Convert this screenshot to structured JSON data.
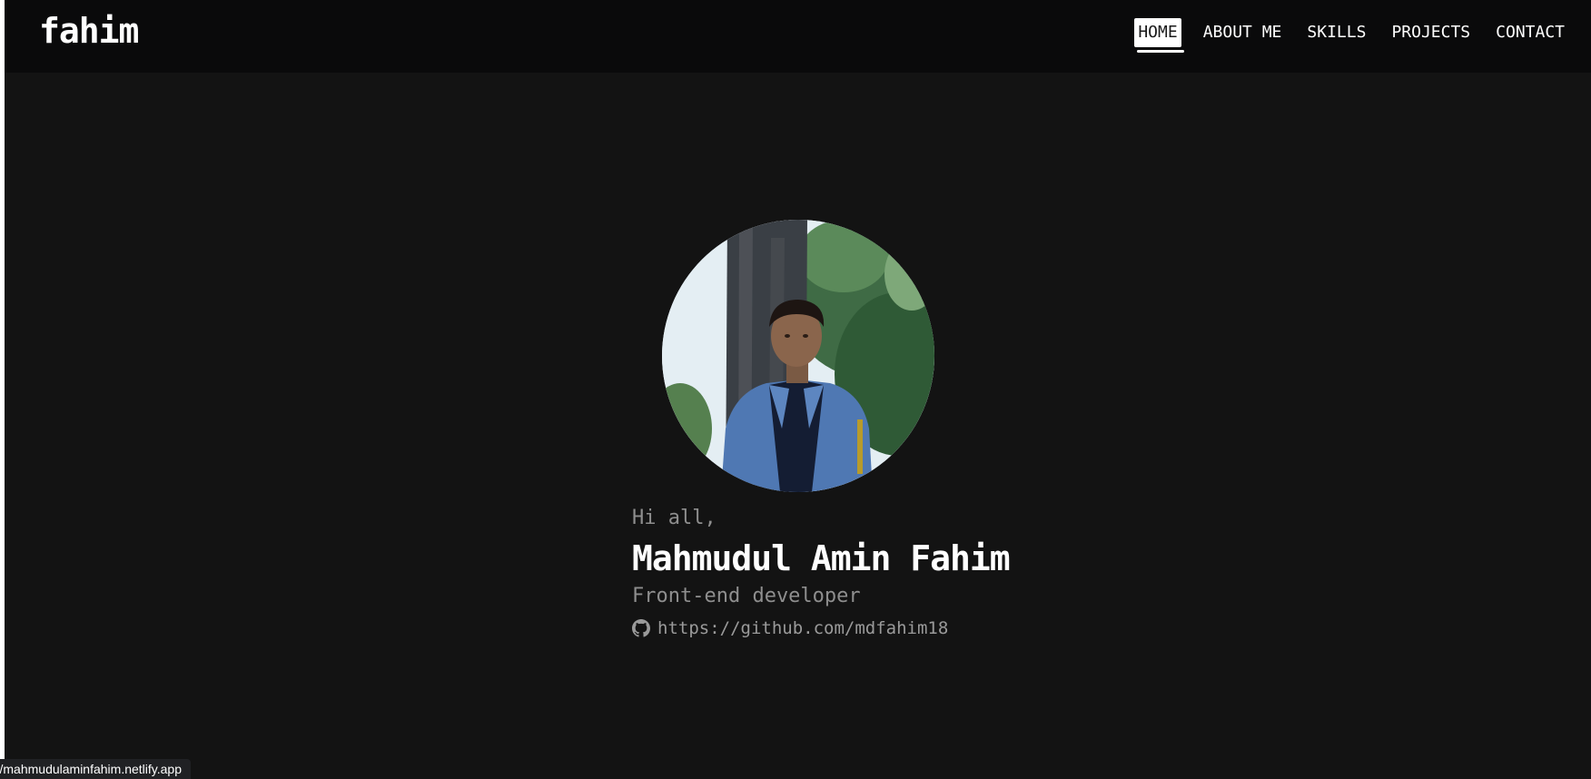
{
  "navbar": {
    "logo": "fahim",
    "items": [
      {
        "label": "HOME",
        "active": true
      },
      {
        "label": "ABOUT ME",
        "active": false
      },
      {
        "label": "SKILLS",
        "active": false
      },
      {
        "label": "PROJECTS",
        "active": false
      },
      {
        "label": "CONTACT",
        "active": false
      }
    ]
  },
  "hero": {
    "avatar_alt": "profile-photo",
    "greeting": "Hi all,",
    "name": "Mahmudul Amin Fahim",
    "role": "Front-end developer",
    "github_icon": "github-icon",
    "github_url": "https://github.com/mdfahim18"
  },
  "status_bar": {
    "url": "https://mahmudulaminfahim.netlify.app"
  },
  "colors": {
    "background": "#131313",
    "navbar": "#0a0a0b",
    "text": "#ffffff",
    "muted": "#8e8e8e"
  }
}
